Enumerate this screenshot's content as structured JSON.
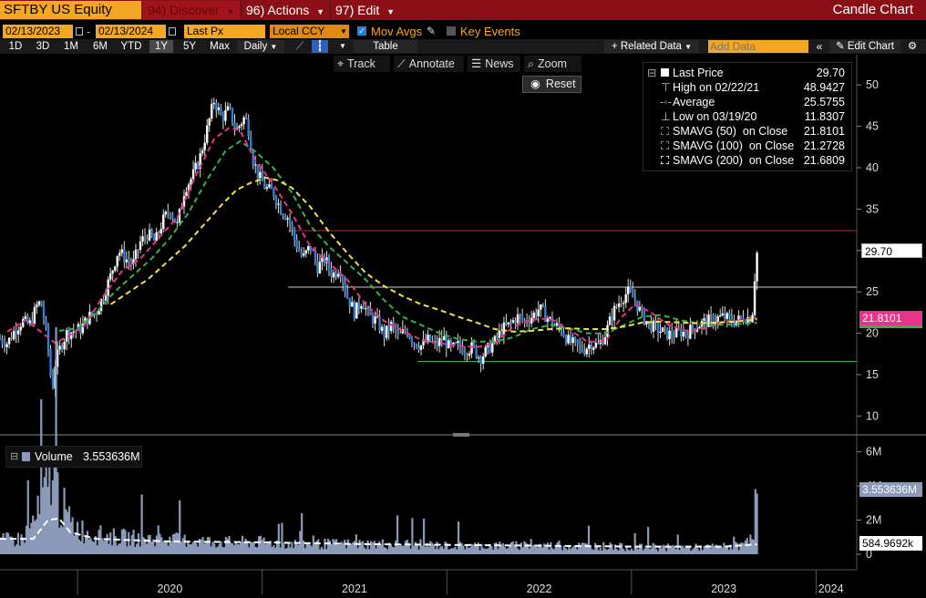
{
  "header": {
    "ticker": "SFTBY US Equity",
    "menus": [
      {
        "label": "94) Discover",
        "dim": true
      },
      {
        "label": "96) Actions",
        "dim": false
      },
      {
        "label": "97) Edit",
        "dim": false
      }
    ],
    "chart_title": "Candle Chart"
  },
  "options": {
    "start_date": "02/13/2023",
    "date_separator": "-",
    "end_date": "02/13/2024",
    "field": "Last Px",
    "currency": "Local CCY",
    "mov_avgs_label": "Mov Avgs",
    "key_events_label": "Key Events"
  },
  "ranges": {
    "items": [
      "1D",
      "3D",
      "1M",
      "6M",
      "YTD",
      "1Y",
      "5Y",
      "Max"
    ],
    "selected": "1Y",
    "frequency": "Daily",
    "table_label": "Table",
    "related_data": "+ Related Data",
    "add_data_placeholder": "Add Data",
    "edit_chart": "Edit Chart"
  },
  "toolbar": {
    "track": "Track",
    "annotate": "Annotate",
    "news": "News",
    "zoom": "Zoom",
    "reset": "Reset"
  },
  "legend": {
    "items": [
      {
        "name": "Last Price",
        "value": "29.70",
        "color": "#ffffff"
      },
      {
        "name": "High on 02/22/21",
        "value": "48.9427",
        "color": "#bbbbbb"
      },
      {
        "name": "Average",
        "value": "25.5755",
        "color": "#bbbbbb"
      },
      {
        "name": "Low on 03/19/20",
        "value": "11.8307",
        "color": "#bbbbbb"
      },
      {
        "name": "SMAVG (50)  on Close",
        "value": "21.8101",
        "color": "#e8338a"
      },
      {
        "name": "SMAVG (100)  on Close",
        "value": "21.2728",
        "color": "#35b34a"
      },
      {
        "name": "SMAVG (200)  on Close",
        "value": "21.6809",
        "color": "#f0e14a"
      }
    ]
  },
  "price_tags": {
    "last": "29.70",
    "sma50": "21.8101"
  },
  "volume_panel": {
    "label": "Volume",
    "value": "3.553636M",
    "tag_last": "3.553636M",
    "tag_avg": "584.9692k"
  },
  "chart_data": {
    "type": "candlestick",
    "price_axis": {
      "ticks": [
        "50",
        "45",
        "40",
        "35",
        "30",
        "25",
        "20",
        "15",
        "10"
      ],
      "ylim": [
        8.5,
        52
      ]
    },
    "volume_axis": {
      "ticks": [
        "6M",
        "4M",
        "2M",
        "0"
      ],
      "ylim": [
        0,
        6.3
      ]
    },
    "x_labels": [
      "2020",
      "2021",
      "2022",
      "2023",
      "2024"
    ],
    "x_range": [
      2019.58,
      2024.22
    ],
    "year_starts": [
      2020,
      2021,
      2022,
      2023,
      2024
    ],
    "reference_lines": {
      "high": 48.9427,
      "average": 25.5755,
      "low": 11.8307,
      "red_line": 32.4,
      "green_line": 16.6
    },
    "price_keypoints": [
      [
        2019.58,
        19.3
      ],
      [
        2019.62,
        18.8
      ],
      [
        2019.66,
        20.4
      ],
      [
        2019.7,
        21.5
      ],
      [
        2019.74,
        21.0
      ],
      [
        2019.78,
        23.3
      ],
      [
        2019.8,
        23.8
      ],
      [
        2019.82,
        21.5
      ],
      [
        2019.85,
        16.8
      ],
      [
        2019.86,
        12.4
      ],
      [
        2019.88,
        16.5
      ],
      [
        2019.91,
        18.5
      ],
      [
        2019.94,
        20.0
      ],
      [
        2019.98,
        20.3
      ],
      [
        2020.02,
        20.6
      ],
      [
        2020.06,
        22.0
      ],
      [
        2020.1,
        22.5
      ],
      [
        2020.14,
        24.5
      ],
      [
        2020.18,
        27.0
      ],
      [
        2020.22,
        30.0
      ],
      [
        2020.26,
        29.0
      ],
      [
        2020.3,
        28.3
      ],
      [
        2020.34,
        31.0
      ],
      [
        2020.38,
        32.0
      ],
      [
        2020.42,
        31.0
      ],
      [
        2020.46,
        33.5
      ],
      [
        2020.5,
        35.0
      ],
      [
        2020.54,
        33.0
      ],
      [
        2020.58,
        37.5
      ],
      [
        2020.62,
        38.8
      ],
      [
        2020.66,
        41.0
      ],
      [
        2020.7,
        44.5
      ],
      [
        2020.74,
        48.2
      ],
      [
        2020.78,
        46.0
      ],
      [
        2020.82,
        47.0
      ],
      [
        2020.86,
        44.5
      ],
      [
        2020.9,
        46.0
      ],
      [
        2020.92,
        45.5
      ],
      [
        2020.95,
        41.0
      ],
      [
        2020.98,
        39.0
      ],
      [
        2021.02,
        37.5
      ],
      [
        2021.06,
        37.0
      ],
      [
        2021.1,
        35.0
      ],
      [
        2021.14,
        34.0
      ],
      [
        2021.18,
        31.0
      ],
      [
        2021.22,
        29.0
      ],
      [
        2021.26,
        30.5
      ],
      [
        2021.3,
        28.0
      ],
      [
        2021.34,
        29.0
      ],
      [
        2021.38,
        27.0
      ],
      [
        2021.42,
        28.0
      ],
      [
        2021.46,
        24.5
      ],
      [
        2021.5,
        22.5
      ],
      [
        2021.54,
        24.0
      ],
      [
        2021.58,
        22.0
      ],
      [
        2021.62,
        21.5
      ],
      [
        2021.66,
        19.8
      ],
      [
        2021.7,
        21.0
      ],
      [
        2021.74,
        19.5
      ],
      [
        2021.78,
        20.5
      ],
      [
        2021.82,
        19.0
      ],
      [
        2021.86,
        18.5
      ],
      [
        2021.9,
        19.2
      ],
      [
        2021.94,
        18.5
      ],
      [
        2021.98,
        19.5
      ],
      [
        2022.02,
        18.0
      ],
      [
        2022.06,
        18.5
      ],
      [
        2022.1,
        18.0
      ],
      [
        2022.14,
        18.3
      ],
      [
        2022.18,
        17.0
      ],
      [
        2022.22,
        18.0
      ],
      [
        2022.26,
        19.0
      ],
      [
        2022.3,
        20.5
      ],
      [
        2022.34,
        21.0
      ],
      [
        2022.38,
        22.0
      ],
      [
        2022.42,
        21.5
      ],
      [
        2022.46,
        22.0
      ],
      [
        2022.5,
        23.0
      ],
      [
        2022.54,
        22.0
      ],
      [
        2022.58,
        21.0
      ],
      [
        2022.62,
        20.5
      ],
      [
        2022.66,
        19.0
      ],
      [
        2022.7,
        18.5
      ],
      [
        2022.74,
        18.0
      ],
      [
        2022.78,
        18.8
      ],
      [
        2022.82,
        18.5
      ],
      [
        2022.86,
        20.0
      ],
      [
        2022.9,
        22.5
      ],
      [
        2022.94,
        24.0
      ],
      [
        2022.98,
        25.0
      ],
      [
        2023.02,
        24.0
      ],
      [
        2023.06,
        22.0
      ],
      [
        2023.1,
        21.0
      ],
      [
        2023.14,
        20.5
      ],
      [
        2023.18,
        20.0
      ],
      [
        2023.22,
        19.8
      ],
      [
        2023.26,
        20.2
      ],
      [
        2023.3,
        20.0
      ],
      [
        2023.34,
        20.8
      ],
      [
        2023.38,
        21.2
      ],
      [
        2023.42,
        21.5
      ],
      [
        2023.46,
        21.8
      ],
      [
        2023.5,
        22.0
      ],
      [
        2023.54,
        21.5
      ],
      [
        2023.58,
        21.6
      ],
      [
        2023.62,
        22.0
      ],
      [
        2023.64,
        21.8
      ],
      [
        2023.66,
        23.0
      ],
      [
        2023.67,
        28.0
      ],
      [
        2023.68,
        29.7
      ]
    ],
    "sma_series": [
      {
        "name": "SMAVG (50)",
        "color": "#e8338a",
        "points": [
          [
            2019.62,
            20.2
          ],
          [
            2019.72,
            21.6
          ],
          [
            2019.8,
            20.2
          ],
          [
            2019.88,
            18.8
          ],
          [
            2019.96,
            19.8
          ],
          [
            2020.04,
            21.0
          ],
          [
            2020.14,
            24.5
          ],
          [
            2020.24,
            27.5
          ],
          [
            2020.34,
            29.0
          ],
          [
            2020.44,
            31.5
          ],
          [
            2020.54,
            34.0
          ],
          [
            2020.64,
            39.0
          ],
          [
            2020.74,
            43.5
          ],
          [
            2020.82,
            44.8
          ],
          [
            2020.88,
            44.5
          ],
          [
            2020.96,
            41.0
          ],
          [
            2021.06,
            38.0
          ],
          [
            2021.16,
            34.5
          ],
          [
            2021.26,
            30.5
          ],
          [
            2021.36,
            28.5
          ],
          [
            2021.46,
            26.5
          ],
          [
            2021.56,
            23.5
          ],
          [
            2021.66,
            21.5
          ],
          [
            2021.76,
            20.3
          ],
          [
            2021.86,
            19.2
          ],
          [
            2021.96,
            18.8
          ],
          [
            2022.06,
            18.5
          ],
          [
            2022.16,
            18.3
          ],
          [
            2022.26,
            18.8
          ],
          [
            2022.36,
            20.8
          ],
          [
            2022.46,
            21.6
          ],
          [
            2022.56,
            21.8
          ],
          [
            2022.66,
            20.5
          ],
          [
            2022.76,
            19.0
          ],
          [
            2022.86,
            19.0
          ],
          [
            2022.94,
            21.8
          ],
          [
            2023.02,
            23.5
          ],
          [
            2023.1,
            22.6
          ],
          [
            2023.2,
            21.0
          ],
          [
            2023.3,
            20.3
          ],
          [
            2023.4,
            20.6
          ],
          [
            2023.5,
            21.4
          ],
          [
            2023.6,
            21.6
          ],
          [
            2023.68,
            21.81
          ]
        ]
      },
      {
        "name": "SMAVG (100)",
        "color": "#35b34a",
        "points": [
          [
            2019.9,
            20.3
          ],
          [
            2020.0,
            20.6
          ],
          [
            2020.1,
            22.5
          ],
          [
            2020.2,
            25.0
          ],
          [
            2020.3,
            27.0
          ],
          [
            2020.4,
            29.0
          ],
          [
            2020.5,
            31.5
          ],
          [
            2020.6,
            34.5
          ],
          [
            2020.7,
            38.5
          ],
          [
            2020.8,
            42.0
          ],
          [
            2020.88,
            43.2
          ],
          [
            2020.96,
            42.0
          ],
          [
            2021.06,
            40.0
          ],
          [
            2021.16,
            37.0
          ],
          [
            2021.26,
            33.0
          ],
          [
            2021.36,
            30.5
          ],
          [
            2021.46,
            28.5
          ],
          [
            2021.56,
            26.5
          ],
          [
            2021.66,
            24.0
          ],
          [
            2021.76,
            22.0
          ],
          [
            2021.86,
            21.0
          ],
          [
            2021.96,
            20.0
          ],
          [
            2022.06,
            19.3
          ],
          [
            2022.16,
            19.0
          ],
          [
            2022.26,
            19.0
          ],
          [
            2022.36,
            19.5
          ],
          [
            2022.46,
            20.5
          ],
          [
            2022.56,
            21.0
          ],
          [
            2022.66,
            20.6
          ],
          [
            2022.76,
            20.0
          ],
          [
            2022.86,
            20.0
          ],
          [
            2022.96,
            21.0
          ],
          [
            2023.06,
            22.0
          ],
          [
            2023.16,
            22.2
          ],
          [
            2023.26,
            21.6
          ],
          [
            2023.36,
            21.2
          ],
          [
            2023.46,
            21.0
          ],
          [
            2023.56,
            21.1
          ],
          [
            2023.68,
            21.27
          ]
        ]
      },
      {
        "name": "SMAVG (200)",
        "color": "#f0e14a",
        "points": [
          [
            2020.18,
            23.5
          ],
          [
            2020.28,
            25.0
          ],
          [
            2020.38,
            26.5
          ],
          [
            2020.48,
            28.5
          ],
          [
            2020.58,
            30.5
          ],
          [
            2020.68,
            33.0
          ],
          [
            2020.78,
            35.5
          ],
          [
            2020.86,
            37.3
          ],
          [
            2020.94,
            38.2
          ],
          [
            2021.02,
            38.8
          ],
          [
            2021.08,
            38.5
          ],
          [
            2021.16,
            37.6
          ],
          [
            2021.26,
            35.3
          ],
          [
            2021.36,
            32.3
          ],
          [
            2021.46,
            29.7
          ],
          [
            2021.56,
            27.3
          ],
          [
            2021.66,
            25.7
          ],
          [
            2021.76,
            24.5
          ],
          [
            2021.86,
            23.5
          ],
          [
            2021.96,
            22.8
          ],
          [
            2022.06,
            22.0
          ],
          [
            2022.16,
            21.3
          ],
          [
            2022.26,
            20.5
          ],
          [
            2022.36,
            20.2
          ],
          [
            2022.46,
            20.3
          ],
          [
            2022.56,
            20.5
          ],
          [
            2022.66,
            20.6
          ],
          [
            2022.76,
            20.5
          ],
          [
            2022.86,
            20.5
          ],
          [
            2022.96,
            20.8
          ],
          [
            2023.06,
            21.3
          ],
          [
            2023.16,
            21.4
          ],
          [
            2023.26,
            21.3
          ],
          [
            2023.36,
            21.2
          ],
          [
            2023.46,
            21.3
          ],
          [
            2023.56,
            21.4
          ],
          [
            2023.68,
            21.68
          ]
        ]
      }
    ],
    "volume_keypoints": [
      [
        2019.58,
        0.8
      ],
      [
        2019.7,
        0.9
      ],
      [
        2019.8,
        2.5
      ],
      [
        2019.84,
        4.2
      ],
      [
        2019.86,
        5.5
      ],
      [
        2019.9,
        3.2
      ],
      [
        2019.96,
        1.8
      ],
      [
        2020.06,
        1.2
      ],
      [
        2020.2,
        1.0
      ],
      [
        2020.4,
        0.9
      ],
      [
        2020.6,
        0.8
      ],
      [
        2020.8,
        0.7
      ],
      [
        2021.0,
        0.7
      ],
      [
        2021.2,
        0.6
      ],
      [
        2021.4,
        0.6
      ],
      [
        2021.6,
        0.6
      ],
      [
        2021.8,
        0.6
      ],
      [
        2022.0,
        0.5
      ],
      [
        2022.2,
        0.5
      ],
      [
        2022.4,
        0.5
      ],
      [
        2022.6,
        0.5
      ],
      [
        2022.8,
        0.5
      ],
      [
        2023.0,
        0.4
      ],
      [
        2023.2,
        0.4
      ],
      [
        2023.4,
        0.4
      ],
      [
        2023.6,
        0.5
      ],
      [
        2023.66,
        1.5
      ],
      [
        2023.68,
        3.55
      ]
    ],
    "volume_avg_keypoints": [
      [
        2019.58,
        0.9
      ],
      [
        2019.76,
        0.9
      ],
      [
        2019.84,
        2.0
      ],
      [
        2019.9,
        2.1
      ],
      [
        2019.96,
        1.3
      ],
      [
        2020.1,
        0.9
      ],
      [
        2020.5,
        0.75
      ],
      [
        2021.0,
        0.7
      ],
      [
        2021.5,
        0.6
      ],
      [
        2022.0,
        0.55
      ],
      [
        2022.5,
        0.5
      ],
      [
        2023.0,
        0.45
      ],
      [
        2023.5,
        0.45
      ],
      [
        2023.68,
        0.58
      ]
    ]
  }
}
